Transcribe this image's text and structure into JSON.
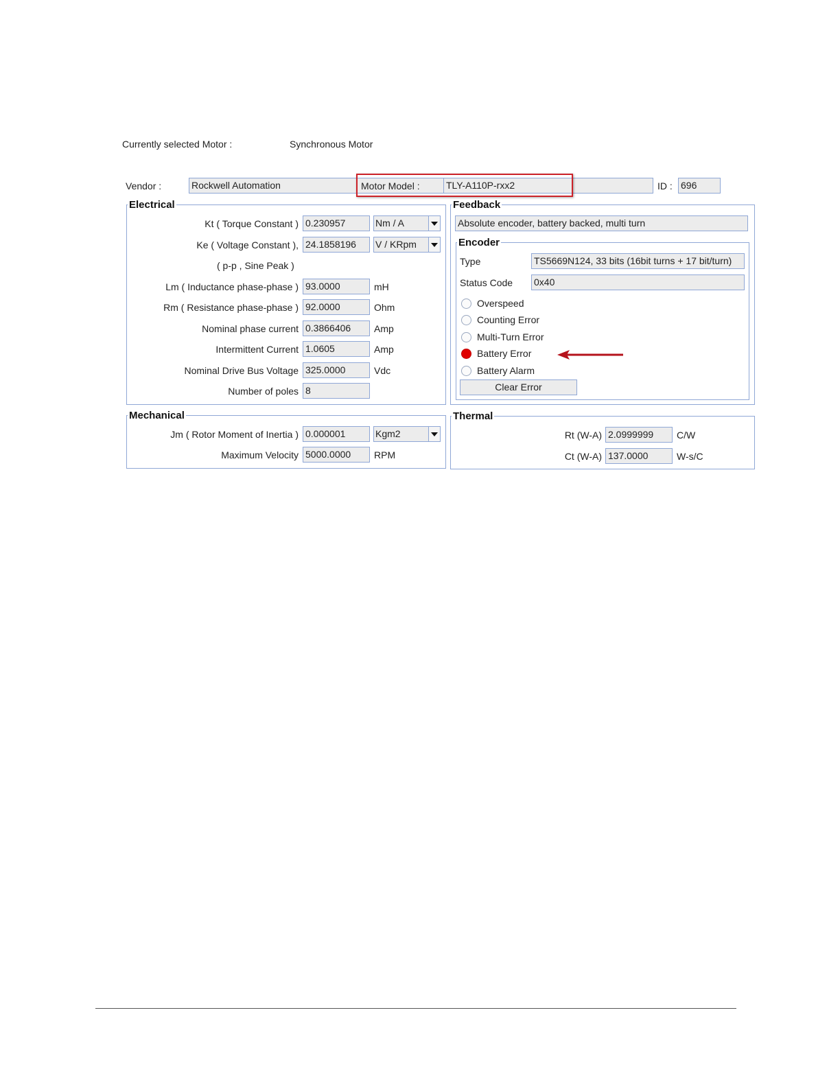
{
  "header": {
    "current_motor_label": "Currently selected Motor :",
    "current_motor_value": "Synchronous Motor"
  },
  "identity": {
    "vendor_label": "Vendor :",
    "vendor_value": "Rockwell Automation",
    "model_label": "Motor Model :",
    "model_value": "TLY-A110P-rxx2",
    "id_label": "ID :",
    "id_value": "696"
  },
  "electrical": {
    "title": "Electrical",
    "kt_label": "Kt ( Torque Constant )",
    "kt_value": "0.230957",
    "kt_unit": "Nm / A",
    "ke_label": "Ke ( Voltage Constant ),",
    "ke_value": "24.1858196",
    "ke_unit": "V / KRpm",
    "ke_note": "( p-p , Sine Peak )",
    "lm_label": "Lm ( Inductance phase-phase )",
    "lm_value": "93.0000",
    "lm_unit": "mH",
    "rm_label": "Rm ( Resistance phase-phase )",
    "rm_value": "92.0000",
    "rm_unit": "Ohm",
    "nom_current_label": "Nominal phase current",
    "nom_current_value": "0.3866406",
    "nom_current_unit": "Amp",
    "int_current_label": "Intermittent Current",
    "int_current_value": "1.0605",
    "int_current_unit": "Amp",
    "bus_voltage_label": "Nominal Drive Bus Voltage",
    "bus_voltage_value": "325.0000",
    "bus_voltage_unit": "Vdc",
    "poles_label": "Number of poles",
    "poles_value": "8"
  },
  "mechanical": {
    "title": "Mechanical",
    "jm_label": "Jm ( Rotor Moment of Inertia )",
    "jm_value": "0.000001",
    "jm_unit": "Kgm2",
    "vel_label": "Maximum Velocity",
    "vel_value": "5000.0000",
    "vel_unit": "RPM"
  },
  "feedback": {
    "title": "Feedback",
    "description": "Absolute encoder, battery backed, multi turn",
    "encoder": {
      "title": "Encoder",
      "type_label": "Type",
      "type_value": "TS5669N124, 33 bits (16bit turns + 17 bit/turn)",
      "status_label": "Status Code",
      "status_value": "0x40",
      "errors": [
        {
          "label": "Overspeed",
          "active": false
        },
        {
          "label": "Counting Error",
          "active": false
        },
        {
          "label": "Multi-Turn Error",
          "active": false
        },
        {
          "label": "Battery Error",
          "active": true
        },
        {
          "label": "Battery Alarm",
          "active": false
        }
      ],
      "clear_button": "Clear Error"
    }
  },
  "thermal": {
    "title": "Thermal",
    "rt_label": "Rt (W-A)",
    "rt_value": "2.0999999",
    "rt_unit": "C/W",
    "ct_label": "Ct (W-A)",
    "ct_value": "137.0000",
    "ct_unit": "W-s/C"
  },
  "colors": {
    "highlight_box": "#cc2229",
    "annotation_arrow": "#b5121b",
    "active_indicator": "#e00000"
  }
}
